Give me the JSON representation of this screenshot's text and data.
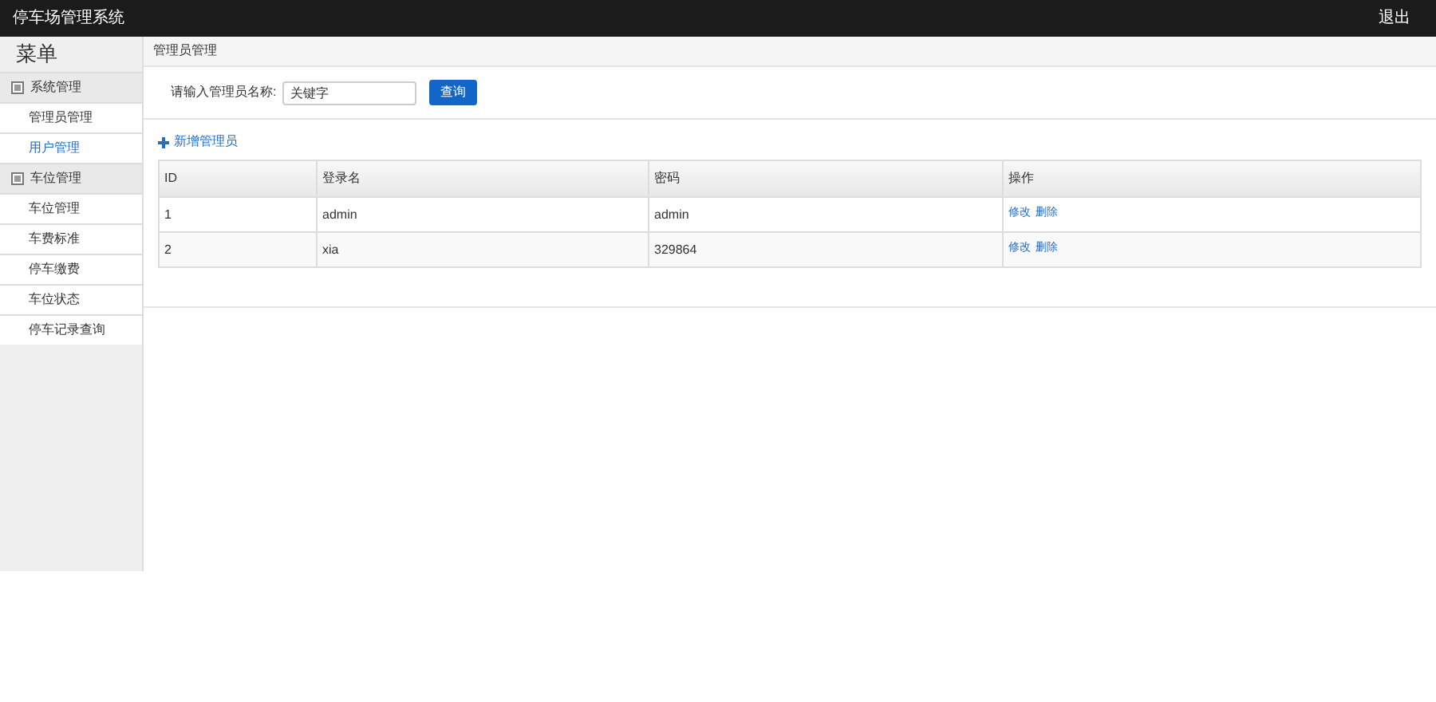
{
  "header": {
    "title": "停车场管理系统",
    "logout": "退出"
  },
  "sidebar": {
    "title": "菜单",
    "groups": [
      {
        "label": "系统管理",
        "items": [
          {
            "label": "管理员管理",
            "selected": false
          },
          {
            "label": "用户管理",
            "selected": true
          }
        ]
      },
      {
        "label": "车位管理",
        "items": [
          {
            "label": "车位管理",
            "selected": false
          },
          {
            "label": "车费标准",
            "selected": false
          },
          {
            "label": "停车缴费",
            "selected": false
          },
          {
            "label": "车位状态",
            "selected": false
          },
          {
            "label": "停车记录查询",
            "selected": false
          }
        ]
      }
    ]
  },
  "breadcrumb": "管理员管理",
  "search": {
    "label": "请输入管理员名称:",
    "value": "关键字",
    "button": "查询"
  },
  "add_link": "新增管理员",
  "table": {
    "columns": [
      "ID",
      "登录名",
      "密码",
      "操作"
    ],
    "rows": [
      {
        "cells": [
          "1",
          "admin",
          "admin"
        ],
        "actions": [
          "修改",
          "删除"
        ]
      },
      {
        "cells": [
          "2",
          "xia",
          "329864"
        ],
        "actions": [
          "修改",
          "删除"
        ]
      }
    ]
  }
}
